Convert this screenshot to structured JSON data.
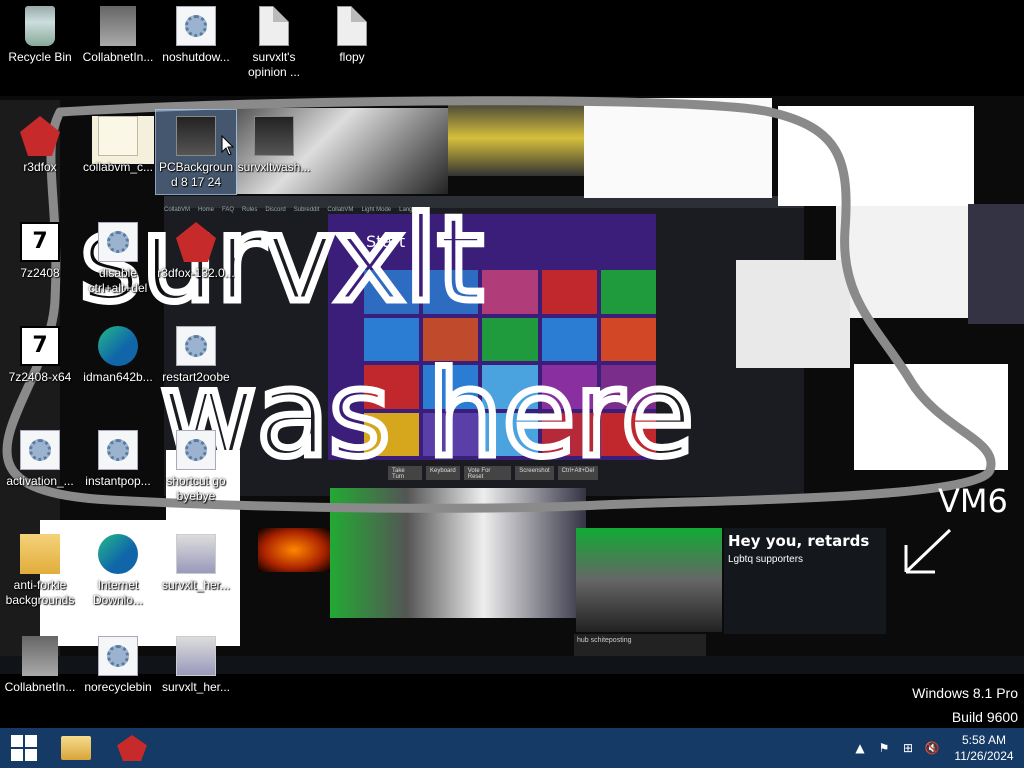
{
  "desktop": {
    "icons": [
      {
        "label": "Recycle Bin",
        "icon": "recycle-bin-icon"
      },
      {
        "label": "CollabnetIn...",
        "icon": "computer-icon"
      },
      {
        "label": "noshutdow...",
        "icon": "settings-file-icon"
      },
      {
        "label": "survxlt's opinion ...",
        "icon": "document-icon"
      },
      {
        "label": "flopy",
        "icon": "document-icon"
      },
      {
        "label": "r3dfox",
        "icon": "r3dfox-icon"
      },
      {
        "label": "collabvm_c...",
        "icon": "certificate-icon"
      },
      {
        "label": "PCBackground 8 17 24",
        "icon": "image-thumbnail-icon"
      },
      {
        "label": "survxltwash...",
        "icon": "image-thumbnail-icon"
      },
      {
        "label": "7z2408",
        "icon": "7zip-icon"
      },
      {
        "label": "disable ctrl+alt+del",
        "icon": "settings-file-icon"
      },
      {
        "label": "r3dfox-132.0...",
        "icon": "r3dfox-icon"
      },
      {
        "label": "7z2408-x64",
        "icon": "7zip-icon"
      },
      {
        "label": "idman642b...",
        "icon": "idm-installer-icon"
      },
      {
        "label": "restart2oobe",
        "icon": "settings-file-icon"
      },
      {
        "label": "activation_...",
        "icon": "settings-file-icon"
      },
      {
        "label": "instantpop...",
        "icon": "settings-file-icon"
      },
      {
        "label": "shortcut go byebye",
        "icon": "settings-file-icon"
      },
      {
        "label": "anti-forkie backgrounds",
        "icon": "folder-icon"
      },
      {
        "label": "Internet Downlo...",
        "icon": "idm-icon"
      },
      {
        "label": "survxlt_her...",
        "icon": "screenshot-icon"
      },
      {
        "label": "CollabnetIn...",
        "icon": "computer-icon"
      },
      {
        "label": "norecyclebin",
        "icon": "settings-file-icon"
      },
      {
        "label": "survxlt_her...",
        "icon": "screenshot-icon"
      }
    ]
  },
  "wallpaper": {
    "graffiti_text": [
      "survxlt",
      "was here"
    ],
    "graffiti_tag": "VM6",
    "start_screen_label": "Start",
    "vm_nav": [
      "CollabVM",
      "Home",
      "FAQ",
      "Rules",
      "Discord",
      "Subreddit",
      "CollabVM",
      "Light Mode",
      "Languages"
    ],
    "vm_buttons": [
      "Take Turn",
      "Keyboard",
      "Vote For Reset",
      "Screenshot",
      "Ctrl+Alt+Del"
    ],
    "tweet_title": "Hey you, retards",
    "tweet_sub": "Lgbtq supporters",
    "comment_text": "hub schiteposting"
  },
  "watermark": {
    "line1": "Windows 8.1 Pro",
    "line2": "Build 9600"
  },
  "taskbar": {
    "pinned": [
      {
        "name": "File Explorer",
        "icon": "file-explorer-icon"
      },
      {
        "name": "r3dfox",
        "icon": "r3dfox-icon"
      }
    ],
    "tray": {
      "time": "5:58 AM",
      "date": "11/26/2024"
    }
  },
  "colors": {
    "taskbar": "#153a66",
    "graffiti_white": "#ffffff",
    "graffiti_gray": "#8a8a8a"
  }
}
